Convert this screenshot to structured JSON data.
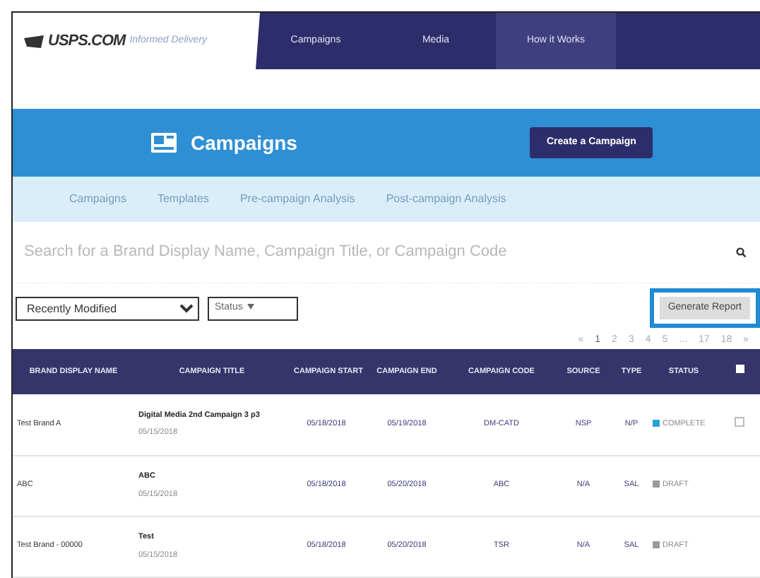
{
  "header": {
    "logo": "USPS.COM",
    "logo_tagline": "Informed Delivery",
    "nav": [
      {
        "label": "Campaigns",
        "selected": false
      },
      {
        "label": "Media",
        "selected": false
      },
      {
        "label": "How it Works",
        "selected": true
      }
    ]
  },
  "banner": {
    "title": "Campaigns",
    "button": "Create a Campaign"
  },
  "subnav": [
    "Campaigns",
    "Templates",
    "Pre-campaign Analysis",
    "Post-campaign Analysis"
  ],
  "search": {
    "placeholder": "Search for a Brand Display Name, Campaign Title, or Campaign Code"
  },
  "filters": {
    "sort": "Recently Modified",
    "status": "Status",
    "report_button": "Generate Report"
  },
  "pagination": [
    "«",
    "1",
    "2",
    "3",
    "4",
    "5",
    "...",
    "17",
    "18",
    "»"
  ],
  "table": {
    "columns": [
      "BRAND DISPLAY NAME",
      "CAMPAIGN TITLE",
      "CAMPAIGN START",
      "CAMPAIGN END",
      "CAMPAIGN CODE",
      "SOURCE",
      "TYPE",
      "STATUS"
    ],
    "select_all_checked": false,
    "rows": [
      {
        "brand": "Test Brand A",
        "title": "Digital Media 2nd Campaign 3 p3",
        "modified": "05/15/2018",
        "start": "05/18/2018",
        "end": "05/19/2018",
        "code": "DM-CATD",
        "source": "NSP",
        "type": "N/P",
        "status": "COMPLETE",
        "color": "#29a3d6",
        "checked": false
      },
      {
        "brand": "ABC",
        "title": "ABC",
        "modified": "05/15/2018",
        "start": "05/18/2018",
        "end": "05/20/2018",
        "code": "ABC",
        "source": "N/A",
        "type": "SAL",
        "status": "DRAFT",
        "color": "#9a9a9a"
      },
      {
        "brand": "Test Brand - 00000",
        "title": "Test",
        "modified": "05/15/2018",
        "start": "05/18/2018",
        "end": "05/20/2018",
        "code": "TSR",
        "source": "N/A",
        "type": "SAL",
        "status": "DRAFT",
        "color": "#9a9a9a"
      }
    ]
  }
}
